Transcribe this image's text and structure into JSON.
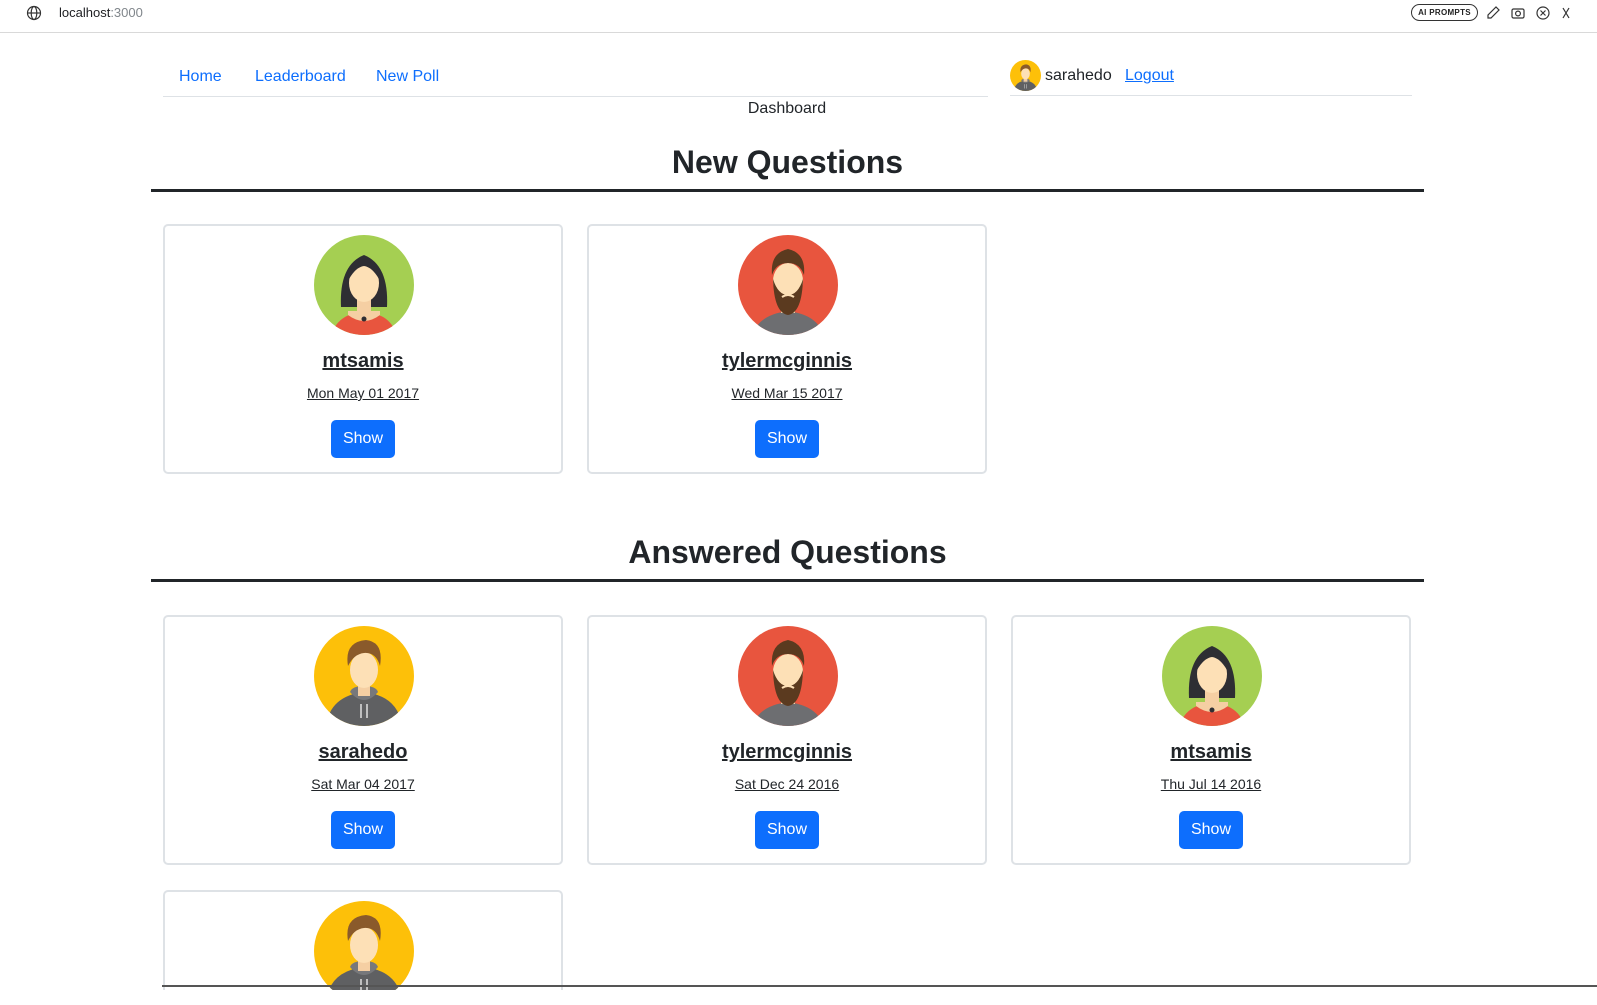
{
  "browser": {
    "host": "localhost",
    "port": ":3000",
    "ai_prompts_label": "AI PROMPTS"
  },
  "nav": {
    "links": [
      "Home",
      "Leaderboard",
      "New Poll"
    ]
  },
  "user": {
    "name": "sarahedo",
    "logout_label": "Logout",
    "avatar": "boy-yellow-avatar-icon"
  },
  "page": {
    "subtitle": "Dashboard"
  },
  "sections": {
    "new_title": "New Questions",
    "answered_title": "Answered Questions"
  },
  "new_questions": [
    {
      "author": "mtsamis",
      "date": "Mon May 01 2017",
      "button": "Show",
      "avatar": "woman-green-avatar-icon"
    },
    {
      "author": "tylermcginnis",
      "date": "Wed Mar 15 2017",
      "button": "Show",
      "avatar": "bearded-man-red-avatar-icon"
    }
  ],
  "answered_questions": [
    {
      "author": "sarahedo",
      "date": "Sat Mar 04 2017",
      "button": "Show",
      "avatar": "boy-yellow-avatar-icon"
    },
    {
      "author": "tylermcginnis",
      "date": "Sat Dec 24 2016",
      "button": "Show",
      "avatar": "bearded-man-red-avatar-icon"
    },
    {
      "author": "mtsamis",
      "date": "Thu Jul 14 2016",
      "button": "Show",
      "avatar": "woman-green-avatar-icon"
    },
    {
      "author": "",
      "date": "",
      "button": "",
      "avatar": "boy-yellow-avatar-icon"
    }
  ],
  "colors": {
    "link": "#0d6efd",
    "button": "#0d6efd",
    "avatar_green": "#a5cf52",
    "avatar_red": "#e8553e",
    "avatar_yellow": "#fdc009"
  }
}
